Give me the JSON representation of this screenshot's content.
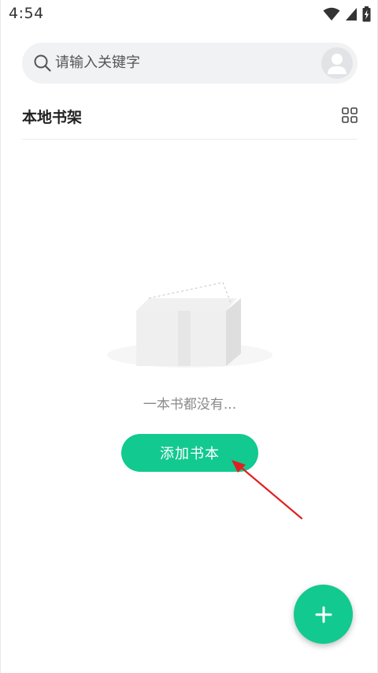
{
  "status_bar": {
    "time": "4:54"
  },
  "search": {
    "placeholder": "请输入关键字",
    "icon": "search-icon"
  },
  "profile": {
    "icon": "user-avatar-icon"
  },
  "shelf": {
    "title": "本地书架",
    "view_toggle_icon": "grid-icon"
  },
  "empty_state": {
    "illustration": "empty-box-icon",
    "message": "一本书都没有..."
  },
  "actions": {
    "add_book_label": "添加书本",
    "fab_icon": "plus-icon"
  },
  "colors": {
    "accent": "#12c98f",
    "annotation_arrow": "#e02020"
  }
}
